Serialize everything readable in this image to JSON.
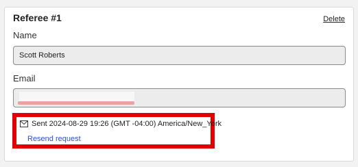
{
  "referee": {
    "title": "Referee #1",
    "delete_label": "Delete",
    "name_label": "Name",
    "name_value": "Scott Roberts",
    "email_label": "Email",
    "email_value": ""
  },
  "request_status": {
    "sent_text": "Sent 2024-08-29 19:26 (GMT -04:00) America/New_York",
    "resend_label": "Resend request",
    "icon": "mail-icon",
    "highlight_color": "#e00000",
    "link_color": "#2d4fd6"
  }
}
